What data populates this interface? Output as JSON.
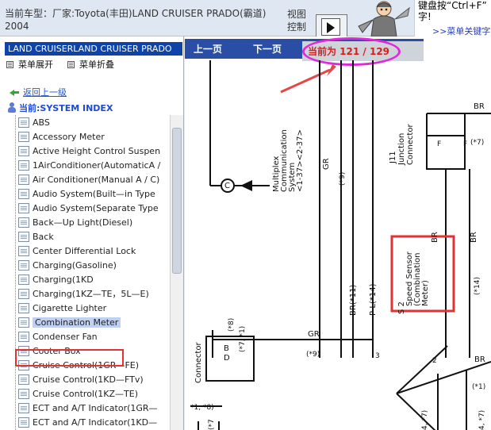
{
  "header": {
    "model_line": "当前车型：厂家:Toyota(丰田)LAND CRUISER PRADO(霸道) 2004",
    "view_control": "视图控制",
    "help_text_line1": "键盘按“Ctrl+F”",
    "help_text_line2": "字!",
    "help_link": ">>菜单关键字"
  },
  "sidebar": {
    "car_title": "LAND CRUISERLAND CRUISER PRADO",
    "expand_label": "菜单展开",
    "collapse_label": "菜单折叠",
    "back_link": "返回上一级",
    "current_label": "当前:SYSTEM INDEX",
    "items": [
      {
        "label": "ABS"
      },
      {
        "label": "Accessory Meter"
      },
      {
        "label": "Active Height Control Suspen"
      },
      {
        "label": "1AirConditioner(AutomaticA /"
      },
      {
        "label": "Air Conditioner(Manual A / C)"
      },
      {
        "label": "Audio System(Built—in Type"
      },
      {
        "label": "Audio System(Separate Type"
      },
      {
        "label": "Back—Up Light(Diesel)"
      },
      {
        "label": "Back"
      },
      {
        "label": "Center DifferentiaI Lock"
      },
      {
        "label": "Charging(Gasoline)"
      },
      {
        "label": "Charging(1KD"
      },
      {
        "label": "Charging(1KZ—TE，5L—E)"
      },
      {
        "label": "Cigarette Lighter"
      },
      {
        "label": "Combination Meter",
        "selected": true
      },
      {
        "label": "Condenser Fan"
      },
      {
        "label": "Cooter Box"
      },
      {
        "label": "Cruise Control(1GR—FE)"
      },
      {
        "label": "Cruise Control(1KD—FTv)"
      },
      {
        "label": "Cruise Control(1KZ—TE)"
      },
      {
        "label": "ECT and A/T Indicator(1GR—"
      },
      {
        "label": "ECT and A/T Indicator(1KD—"
      }
    ]
  },
  "nav": {
    "prev": "上一页",
    "next": "下一页",
    "page_info": "当前为 121 / 129"
  },
  "diagram": {
    "labels": {
      "c_node": "C",
      "multiplex": "Multiplex",
      "communication": "Communication",
      "system": "System",
      "pins": "<1-37><2-37>",
      "gr_top": "GR",
      "star9": "(*9)",
      "j11": "J11",
      "junction": "Junction",
      "connector_top": "Connector",
      "br_top": "BR",
      "f_left": "F",
      "f_right": "F",
      "star7_top": "(*7)",
      "br_mid": "BR",
      "br_mid2": "BR",
      "br_star11": "BR(*11)",
      "pl_star14": "P-L(*14)",
      "s2": "S 2",
      "speed_sensor": "Speed Sensor",
      "combination": "(Combination",
      "meter": "Meter)",
      "star14": "(*14)",
      "star8": "(*8)",
      "star7_1": "(*7, *1)",
      "b_pin": "B",
      "d_pin": "D",
      "connector_left": "Connector",
      "gr_bottom": "GR",
      "star9_bottom": "(*9)",
      "pin3": "3",
      "pin2": "2",
      "br_bottom": "BR",
      "star1": "(*1)",
      "star1_8": "*1, *8)",
      "star7_b": "(*7",
      "star4": "4, *7)",
      "pin4": "4, *7)"
    }
  },
  "colors": {
    "nav_bg": "#2a4ea6",
    "title_bg": "#0f43a8",
    "highlight": "#e03333",
    "ellipse": "#e02ad7",
    "link": "#1f56d8"
  }
}
